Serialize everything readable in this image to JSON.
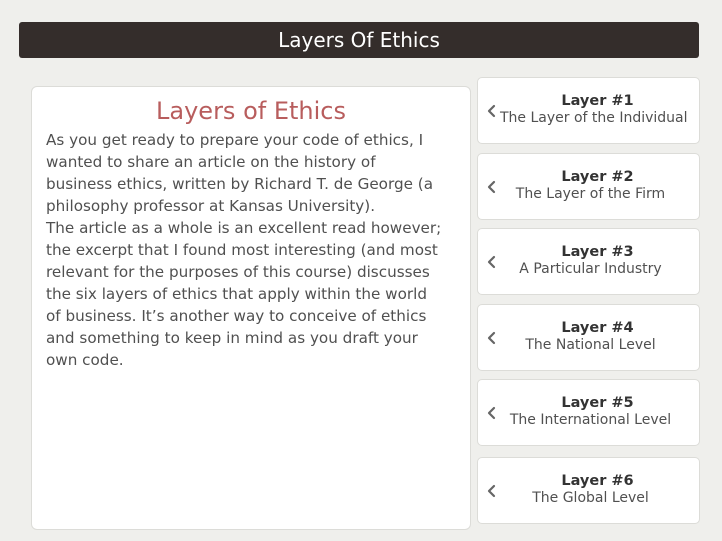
{
  "header": {
    "title": "Layers Of Ethics"
  },
  "content": {
    "heading": "Layers of Ethics",
    "body": "As you get ready to prepare your code of ethics, I\nwanted to share an article on the history of\nbusiness ethics, written by Richard T. de George (a\nphilosophy professor at Kansas University).\nThe article as a whole is an excellent read however;\nthe excerpt that I found most interesting (and most\nrelevant for the purposes of this course) discusses\nthe six layers of ethics that apply within the world\nof business. It’s another way to conceive of ethics\nand something to keep in mind as you draft your\nown code."
  },
  "layers": [
    {
      "title": "Layer #1",
      "subtitle": "The Layer of the Individual"
    },
    {
      "title": "Layer #2",
      "subtitle": "The Layer of the Firm"
    },
    {
      "title": "Layer #3",
      "subtitle": "A Particular Industry"
    },
    {
      "title": "Layer #4",
      "subtitle": "The National Level"
    },
    {
      "title": "Layer #5",
      "subtitle": "The International Level"
    },
    {
      "title": "Layer #6",
      "subtitle": "The Global Level"
    }
  ],
  "colors": {
    "title_bar_bg": "#342d2b",
    "heading_color": "#b85d5d",
    "page_bg": "#efefec"
  },
  "icons": {
    "layer_expand": "chevron-left-icon"
  }
}
